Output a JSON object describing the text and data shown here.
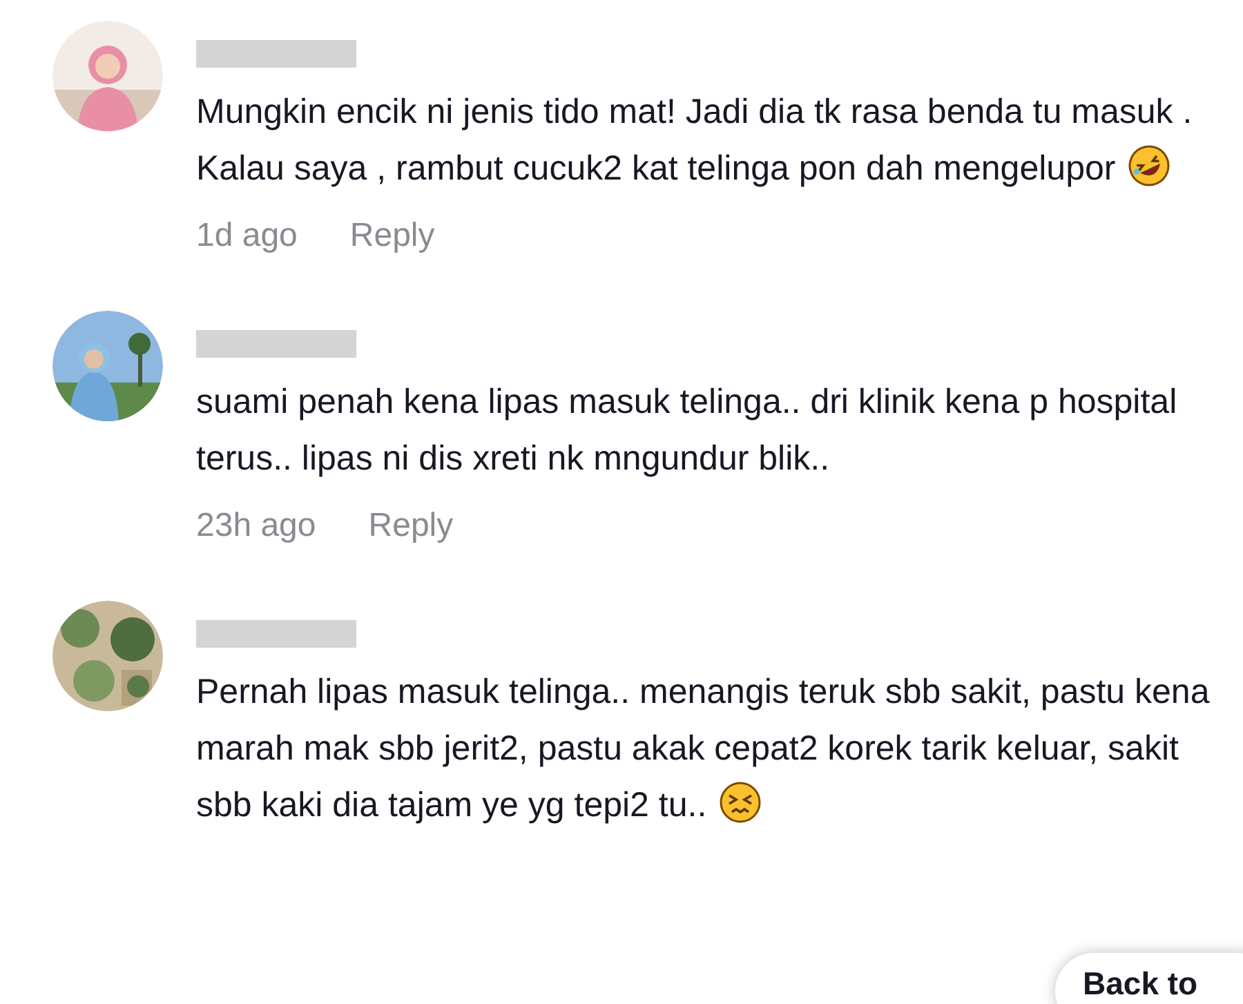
{
  "comments": [
    {
      "kind": "laugh",
      "text": "Mungkin encik ni jenis tido mat! Jadi dia tk rasa benda tu masuk . Kalau saya , rambut cucuk2 kat telinga pon dah mengelupor",
      "time": "1d ago",
      "reply": "Reply"
    },
    {
      "kind": "plain",
      "text": "suami penah kena lipas masuk telinga.. dri klinik kena p hospital terus.. lipas ni dis xreti nk mngundur blik..",
      "time": "23h ago",
      "reply": "Reply"
    },
    {
      "kind": "persevere",
      "text": "Pernah lipas masuk telinga.. menangis teruk sbb sakit, pastu kena marah mak sbb jerit2, pastu akak cepat2 korek tarik keluar, sakit sbb kaki dia tajam ye yg tepi2 tu.."
    }
  ],
  "back_button": "Back to"
}
